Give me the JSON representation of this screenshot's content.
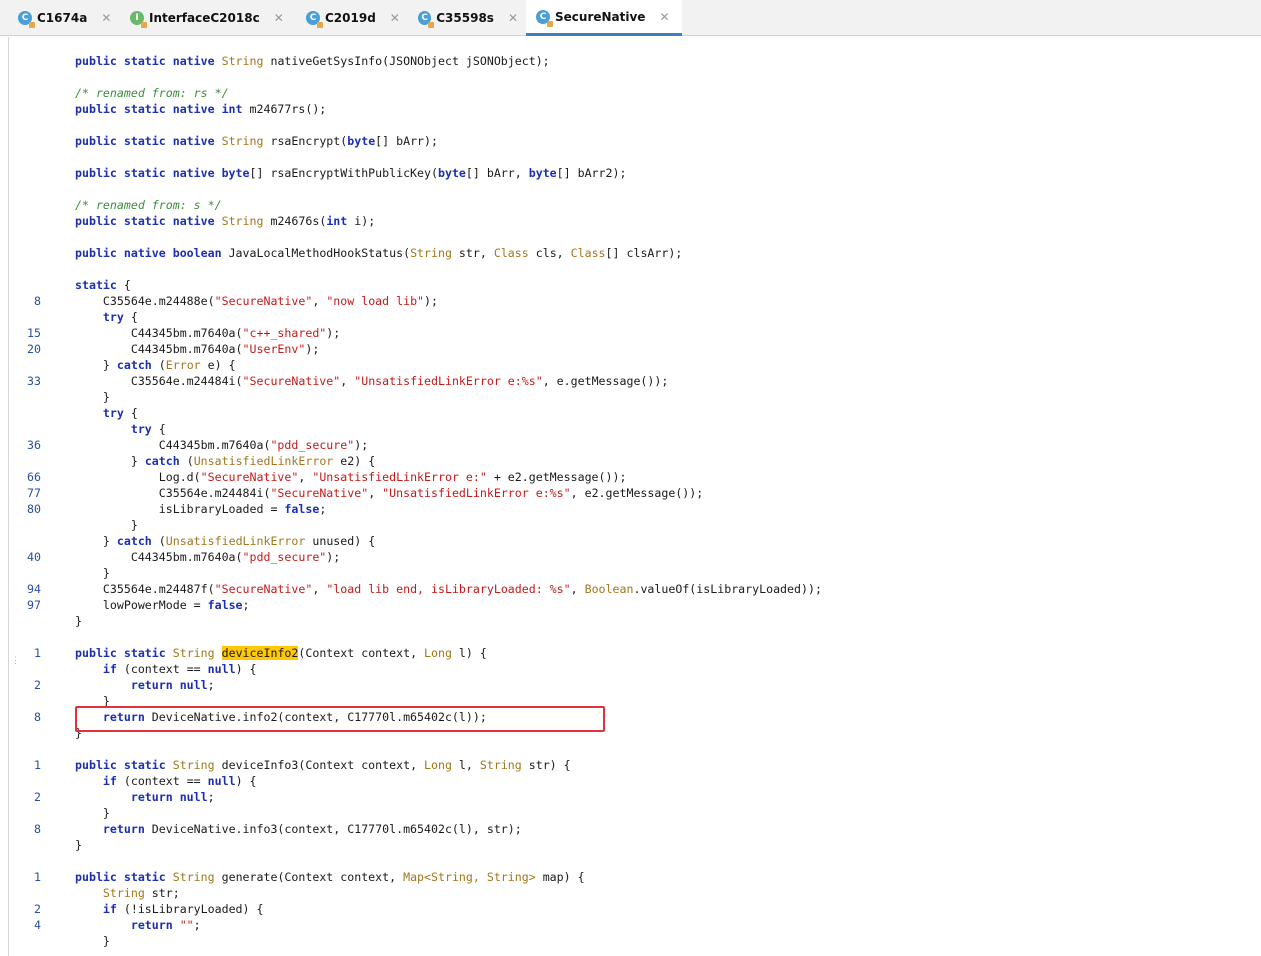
{
  "tabs": [
    {
      "label": "C1674a",
      "icon": "class-icon",
      "closable": true,
      "active": false
    },
    {
      "label": "InterfaceC2018c",
      "icon": "interface-icon",
      "closable": true,
      "active": false
    },
    {
      "label": "C2019d",
      "icon": "class-icon",
      "closable": true,
      "active": false
    },
    {
      "label": "C35598s",
      "icon": "class-icon",
      "closable": true,
      "active": false
    },
    {
      "label": "SecureNative",
      "icon": "class-icon",
      "closable": true,
      "active": true
    }
  ],
  "colors": {
    "keyword": "#1b2fb5",
    "string": "#c41a1a",
    "comment": "#3d8c3d",
    "type": "#a3761c",
    "highlight": "#ffc800",
    "annotation_box": "#e2323b",
    "line_number": "#2a4fa0",
    "active_tab_underline": "#3c7ec9"
  },
  "code_lines": [
    {
      "n": "",
      "tokens": [
        [
          "k",
          "public static native "
        ],
        [
          "y",
          "String"
        ],
        [
          "d",
          " nativeGetSysInfo(JSONObject jSONObject);"
        ]
      ]
    },
    {
      "n": "",
      "tokens": []
    },
    {
      "n": "",
      "tokens": [
        [
          "c",
          "/* renamed from: rs */"
        ]
      ]
    },
    {
      "n": "",
      "tokens": [
        [
          "k",
          "public static native int"
        ],
        [
          "d",
          " m24677rs();"
        ]
      ]
    },
    {
      "n": "",
      "tokens": []
    },
    {
      "n": "",
      "tokens": [
        [
          "k",
          "public static native "
        ],
        [
          "y",
          "String"
        ],
        [
          "d",
          " rsaEncrypt("
        ],
        [
          "k",
          "byte"
        ],
        [
          "d",
          "[] bArr);"
        ]
      ]
    },
    {
      "n": "",
      "tokens": []
    },
    {
      "n": "",
      "tokens": [
        [
          "k",
          "public static native byte"
        ],
        [
          "d",
          "[] rsaEncryptWithPublicKey("
        ],
        [
          "k",
          "byte"
        ],
        [
          "d",
          "[] bArr, "
        ],
        [
          "k",
          "byte"
        ],
        [
          "d",
          "[] bArr2);"
        ]
      ]
    },
    {
      "n": "",
      "tokens": []
    },
    {
      "n": "",
      "tokens": [
        [
          "c",
          "/* renamed from: s */"
        ]
      ]
    },
    {
      "n": "",
      "tokens": [
        [
          "k",
          "public static native "
        ],
        [
          "y",
          "String"
        ],
        [
          "d",
          " m24676s("
        ],
        [
          "k",
          "int"
        ],
        [
          "d",
          " i);"
        ]
      ]
    },
    {
      "n": "",
      "tokens": []
    },
    {
      "n": "",
      "tokens": [
        [
          "k",
          "public native boolean"
        ],
        [
          "d",
          " JavaLocalMethodHookStatus("
        ],
        [
          "y",
          "String"
        ],
        [
          "d",
          " str, "
        ],
        [
          "y",
          "Class"
        ],
        [
          "d",
          " cls, "
        ],
        [
          "y",
          "Class"
        ],
        [
          "d",
          "[] clsArr);"
        ]
      ]
    },
    {
      "n": "",
      "tokens": []
    },
    {
      "n": "",
      "tokens": [
        [
          "k",
          "static"
        ],
        [
          "d",
          " {"
        ]
      ]
    },
    {
      "n": "8",
      "tokens": [
        [
          "d",
          "    C35564e.m24488e("
        ],
        [
          "s",
          "\"SecureNative\""
        ],
        [
          "d",
          ", "
        ],
        [
          "s",
          "\"now load lib\""
        ],
        [
          "d",
          ");"
        ]
      ]
    },
    {
      "n": "",
      "tokens": [
        [
          "k",
          "    try"
        ],
        [
          "d",
          " {"
        ]
      ]
    },
    {
      "n": "15",
      "tokens": [
        [
          "d",
          "        C44345bm.m7640a("
        ],
        [
          "s",
          "\"c++_shared\""
        ],
        [
          "d",
          ");"
        ]
      ]
    },
    {
      "n": "20",
      "tokens": [
        [
          "d",
          "        C44345bm.m7640a("
        ],
        [
          "s",
          "\"UserEnv\""
        ],
        [
          "d",
          ");"
        ]
      ]
    },
    {
      "n": "",
      "tokens": [
        [
          "d",
          "    } "
        ],
        [
          "k",
          "catch"
        ],
        [
          "d",
          " ("
        ],
        [
          "y",
          "Error"
        ],
        [
          "d",
          " e) {"
        ]
      ]
    },
    {
      "n": "33",
      "tokens": [
        [
          "d",
          "        C35564e.m24484i("
        ],
        [
          "s",
          "\"SecureNative\""
        ],
        [
          "d",
          ", "
        ],
        [
          "s",
          "\"UnsatisfiedLinkError e:%s\""
        ],
        [
          "d",
          ", e.getMessage());"
        ]
      ]
    },
    {
      "n": "",
      "tokens": [
        [
          "d",
          "    }"
        ]
      ]
    },
    {
      "n": "",
      "tokens": [
        [
          "k",
          "    try"
        ],
        [
          "d",
          " {"
        ]
      ]
    },
    {
      "n": "",
      "tokens": [
        [
          "k",
          "        try"
        ],
        [
          "d",
          " {"
        ]
      ]
    },
    {
      "n": "36",
      "tokens": [
        [
          "d",
          "            C44345bm.m7640a("
        ],
        [
          "s",
          "\"pdd_secure\""
        ],
        [
          "d",
          ");"
        ]
      ]
    },
    {
      "n": "",
      "tokens": [
        [
          "d",
          "        } "
        ],
        [
          "k",
          "catch"
        ],
        [
          "d",
          " ("
        ],
        [
          "y",
          "UnsatisfiedLinkError"
        ],
        [
          "d",
          " e2) {"
        ]
      ]
    },
    {
      "n": "66",
      "tokens": [
        [
          "d",
          "            Log.d("
        ],
        [
          "s",
          "\"SecureNative\""
        ],
        [
          "d",
          ", "
        ],
        [
          "s",
          "\"UnsatisfiedLinkError e:\""
        ],
        [
          "d",
          " + e2.getMessage());"
        ]
      ]
    },
    {
      "n": "77",
      "tokens": [
        [
          "d",
          "            C35564e.m24484i("
        ],
        [
          "s",
          "\"SecureNative\""
        ],
        [
          "d",
          ", "
        ],
        [
          "s",
          "\"UnsatisfiedLinkError e:%s\""
        ],
        [
          "d",
          ", e2.getMessage());"
        ]
      ]
    },
    {
      "n": "80",
      "tokens": [
        [
          "d",
          "            isLibraryLoaded = "
        ],
        [
          "k",
          "false"
        ],
        [
          "d",
          ";"
        ]
      ]
    },
    {
      "n": "",
      "tokens": [
        [
          "d",
          "        }"
        ]
      ]
    },
    {
      "n": "",
      "tokens": [
        [
          "d",
          "    } "
        ],
        [
          "k",
          "catch"
        ],
        [
          "d",
          " ("
        ],
        [
          "y",
          "UnsatisfiedLinkError"
        ],
        [
          "d",
          " unused) {"
        ]
      ]
    },
    {
      "n": "40",
      "tokens": [
        [
          "d",
          "        C44345bm.m7640a("
        ],
        [
          "s",
          "\"pdd_secure\""
        ],
        [
          "d",
          ");"
        ]
      ]
    },
    {
      "n": "",
      "tokens": [
        [
          "d",
          "    }"
        ]
      ]
    },
    {
      "n": "94",
      "tokens": [
        [
          "d",
          "    C35564e.m24487f("
        ],
        [
          "s",
          "\"SecureNative\""
        ],
        [
          "d",
          ", "
        ],
        [
          "s",
          "\"load lib end, isLibraryLoaded: %s\""
        ],
        [
          "d",
          ", "
        ],
        [
          "y",
          "Boolean"
        ],
        [
          "d",
          ".valueOf(isLibraryLoaded));"
        ]
      ]
    },
    {
      "n": "97",
      "tokens": [
        [
          "d",
          "    lowPowerMode = "
        ],
        [
          "k",
          "false"
        ],
        [
          "d",
          ";"
        ]
      ]
    },
    {
      "n": "",
      "tokens": [
        [
          "d",
          "}"
        ]
      ]
    },
    {
      "n": "",
      "tokens": []
    },
    {
      "n": "1",
      "tokens": [
        [
          "k",
          "public static "
        ],
        [
          "y",
          "String"
        ],
        [
          "d",
          " "
        ],
        [
          "h",
          "deviceInfo2"
        ],
        [
          "d",
          "(Context context, "
        ],
        [
          "y",
          "Long"
        ],
        [
          "d",
          " l) {"
        ]
      ]
    },
    {
      "n": "",
      "tokens": [
        [
          "k",
          "    if"
        ],
        [
          "d",
          " (context == "
        ],
        [
          "k",
          "null"
        ],
        [
          "d",
          ") {"
        ]
      ]
    },
    {
      "n": "2",
      "tokens": [
        [
          "k",
          "        return null"
        ],
        [
          "d",
          ";"
        ]
      ]
    },
    {
      "n": "",
      "tokens": [
        [
          "d",
          "    }"
        ]
      ]
    },
    {
      "n": "8",
      "tokens": [
        [
          "k",
          "    return"
        ],
        [
          "d",
          " DeviceNative.info2(context, C17770l.m65402c(l));"
        ]
      ]
    },
    {
      "n": "",
      "tokens": [
        [
          "d",
          "}"
        ]
      ]
    },
    {
      "n": "",
      "tokens": []
    },
    {
      "n": "1",
      "tokens": [
        [
          "k",
          "public static "
        ],
        [
          "y",
          "String"
        ],
        [
          "d",
          " deviceInfo3(Context context, "
        ],
        [
          "y",
          "Long"
        ],
        [
          "d",
          " l, "
        ],
        [
          "y",
          "String"
        ],
        [
          "d",
          " str) {"
        ]
      ]
    },
    {
      "n": "",
      "tokens": [
        [
          "k",
          "    if"
        ],
        [
          "d",
          " (context == "
        ],
        [
          "k",
          "null"
        ],
        [
          "d",
          ") {"
        ]
      ]
    },
    {
      "n": "2",
      "tokens": [
        [
          "k",
          "        return null"
        ],
        [
          "d",
          ";"
        ]
      ]
    },
    {
      "n": "",
      "tokens": [
        [
          "d",
          "    }"
        ]
      ]
    },
    {
      "n": "8",
      "tokens": [
        [
          "k",
          "    return"
        ],
        [
          "d",
          " DeviceNative.info3(context, C17770l.m65402c(l), str);"
        ]
      ]
    },
    {
      "n": "",
      "tokens": [
        [
          "d",
          "}"
        ]
      ]
    },
    {
      "n": "",
      "tokens": []
    },
    {
      "n": "1",
      "tokens": [
        [
          "k",
          "public static "
        ],
        [
          "y",
          "String"
        ],
        [
          "d",
          " generate(Context context, "
        ],
        [
          "y",
          "Map<String, String>"
        ],
        [
          "d",
          " map) {"
        ]
      ]
    },
    {
      "n": "",
      "tokens": [
        [
          "y",
          "    String"
        ],
        [
          "d",
          " str;"
        ]
      ]
    },
    {
      "n": "2",
      "tokens": [
        [
          "k",
          "    if"
        ],
        [
          "d",
          " (!isLibraryLoaded) {"
        ]
      ]
    },
    {
      "n": "4",
      "tokens": [
        [
          "k",
          "        return "
        ],
        [
          "s",
          "\"\""
        ],
        [
          "d",
          ";"
        ]
      ]
    },
    {
      "n": "",
      "tokens": [
        [
          "d",
          "    }"
        ]
      ]
    }
  ]
}
